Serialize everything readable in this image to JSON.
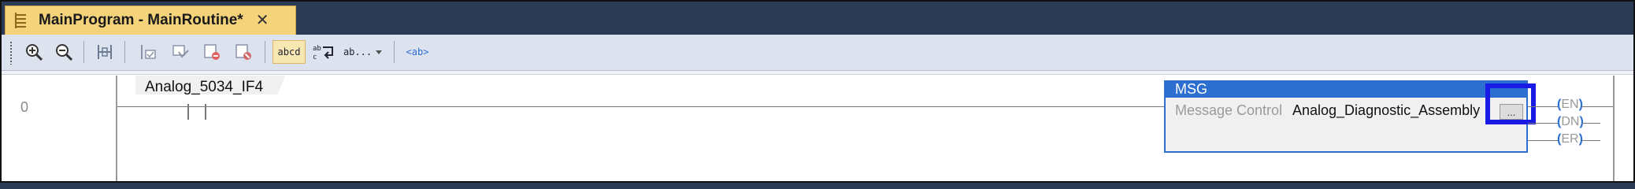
{
  "tab": {
    "title": "MainProgram - MainRoutine*",
    "icon": "routine-icon",
    "close": "✕"
  },
  "toolbar": {
    "buttons": [
      {
        "name": "zoom-in",
        "icon": "zoom-in-icon"
      },
      {
        "name": "zoom-out",
        "icon": "zoom-out-icon"
      },
      {
        "name": "add-rung",
        "icon": "rung-icon"
      },
      {
        "name": "verify-routine",
        "icon": "verify-icon"
      },
      {
        "name": "accept-edits",
        "icon": "accept-icon"
      },
      {
        "name": "cancel-edits",
        "icon": "cancel-icon"
      },
      {
        "name": "finalize-edits",
        "icon": "finalize-icon"
      },
      {
        "name": "show-tag-names",
        "icon": "tag-names-icon",
        "text": "abcd"
      },
      {
        "name": "swap-tags",
        "icon": "swap-icon",
        "text": "ab"
      },
      {
        "name": "tag-description",
        "icon": "description-icon",
        "text": "ab..."
      },
      {
        "name": "address-mode",
        "icon": "address-icon",
        "text": "<ab>"
      }
    ]
  },
  "rung": {
    "number": "0"
  },
  "contact": {
    "tag": "Analog_5034_IF4"
  },
  "msg": {
    "title": "MSG",
    "param_label": "Message Control",
    "param_value": "Analog_Diagnostic_Assembly",
    "ellipsis": "...",
    "outputs": [
      "EN",
      "DN",
      "ER"
    ]
  },
  "colors": {
    "accent": "#2d6fd0",
    "highlight": "#1a1ae6",
    "tab": "#f4d37a"
  }
}
